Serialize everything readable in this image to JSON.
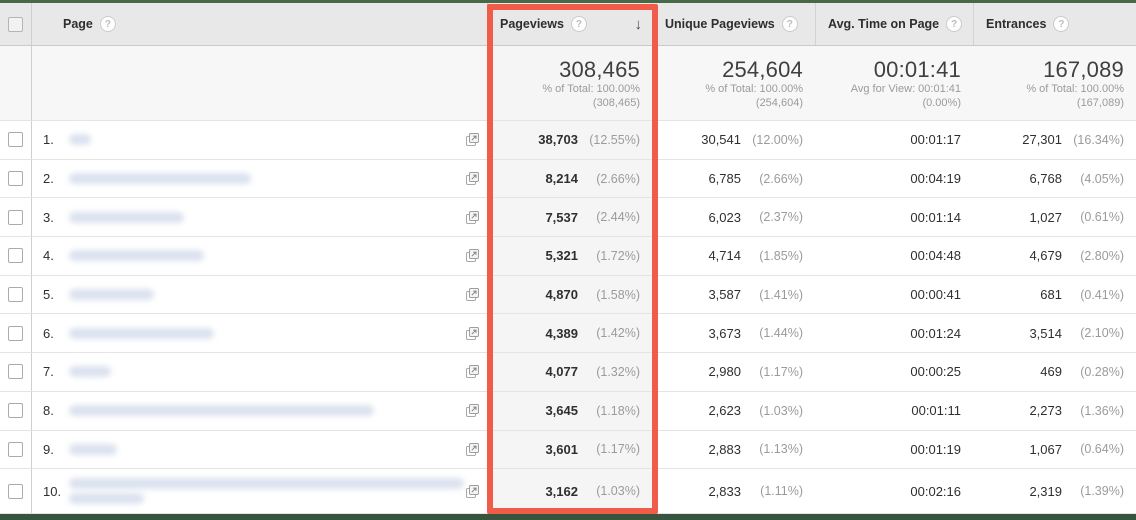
{
  "colors": {
    "highlight_red": "#f05b4a",
    "frame_green_top": "#476948",
    "frame_green_bottom": "#37553c",
    "blur_link": "#dbe2ee"
  },
  "icons": {
    "help": "?",
    "sort_desc": "↓"
  },
  "header": {
    "columns": [
      {
        "label": "Page"
      },
      {
        "label": "Pageviews",
        "sorted": "descending"
      },
      {
        "label": "Unique Pageviews"
      },
      {
        "label": "Avg. Time on Page"
      },
      {
        "label": "Entrances"
      }
    ]
  },
  "summary": {
    "pageviews": {
      "value": "308,465",
      "line2": "% of Total: 100.00%",
      "line3": "(308,465)"
    },
    "unique_pageviews": {
      "value": "254,604",
      "line2": "% of Total: 100.00%",
      "line3": "(254,604)"
    },
    "avg_time_on_page": {
      "value": "00:01:41",
      "line2": "Avg for View: 00:01:41",
      "line3": "(0.00%)"
    },
    "entrances": {
      "value": "167,089",
      "line2": "% of Total: 100.00%",
      "line3": "(167,089)"
    }
  },
  "rows": [
    {
      "index": "1.",
      "blur_bar_widths": [
        22
      ],
      "pageviews": "38,703",
      "pageviews_pct": "(12.55%)",
      "unique_pageviews": "30,541",
      "unique_pageviews_pct": "(12.00%)",
      "avg_time": "00:01:17",
      "entrances": "27,301",
      "entrances_pct": "(16.34%)"
    },
    {
      "index": "2.",
      "blur_bar_widths": [
        182
      ],
      "pageviews": "8,214",
      "pageviews_pct": "(2.66%)",
      "unique_pageviews": "6,785",
      "unique_pageviews_pct": "(2.66%)",
      "avg_time": "00:04:19",
      "entrances": "6,768",
      "entrances_pct": "(4.05%)"
    },
    {
      "index": "3.",
      "blur_bar_widths": [
        115
      ],
      "pageviews": "7,537",
      "pageviews_pct": "(2.44%)",
      "unique_pageviews": "6,023",
      "unique_pageviews_pct": "(2.37%)",
      "avg_time": "00:01:14",
      "entrances": "1,027",
      "entrances_pct": "(0.61%)"
    },
    {
      "index": "4.",
      "blur_bar_widths": [
        135
      ],
      "pageviews": "5,321",
      "pageviews_pct": "(1.72%)",
      "unique_pageviews": "4,714",
      "unique_pageviews_pct": "(1.85%)",
      "avg_time": "00:04:48",
      "entrances": "4,679",
      "entrances_pct": "(2.80%)"
    },
    {
      "index": "5.",
      "blur_bar_widths": [
        85
      ],
      "pageviews": "4,870",
      "pageviews_pct": "(1.58%)",
      "unique_pageviews": "3,587",
      "unique_pageviews_pct": "(1.41%)",
      "avg_time": "00:00:41",
      "entrances": "681",
      "entrances_pct": "(0.41%)"
    },
    {
      "index": "6.",
      "blur_bar_widths": [
        145
      ],
      "pageviews": "4,389",
      "pageviews_pct": "(1.42%)",
      "unique_pageviews": "3,673",
      "unique_pageviews_pct": "(1.44%)",
      "avg_time": "00:01:24",
      "entrances": "3,514",
      "entrances_pct": "(2.10%)"
    },
    {
      "index": "7.",
      "blur_bar_widths": [
        42
      ],
      "pageviews": "4,077",
      "pageviews_pct": "(1.32%)",
      "unique_pageviews": "2,980",
      "unique_pageviews_pct": "(1.17%)",
      "avg_time": "00:00:25",
      "entrances": "469",
      "entrances_pct": "(0.28%)"
    },
    {
      "index": "8.",
      "blur_bar_widths": [
        305
      ],
      "pageviews": "3,645",
      "pageviews_pct": "(1.18%)",
      "unique_pageviews": "2,623",
      "unique_pageviews_pct": "(1.03%)",
      "avg_time": "00:01:11",
      "entrances": "2,273",
      "entrances_pct": "(1.36%)"
    },
    {
      "index": "9.",
      "blur_bar_widths": [
        48
      ],
      "pageviews": "3,601",
      "pageviews_pct": "(1.17%)",
      "unique_pageviews": "2,883",
      "unique_pageviews_pct": "(1.13%)",
      "avg_time": "00:01:19",
      "entrances": "1,067",
      "entrances_pct": "(0.64%)"
    },
    {
      "index": "10.",
      "blur_bar_widths": [
        395,
        75
      ],
      "pageviews": "3,162",
      "pageviews_pct": "(1.03%)",
      "unique_pageviews": "2,833",
      "unique_pageviews_pct": "(1.11%)",
      "avg_time": "00:02:16",
      "entrances": "2,319",
      "entrances_pct": "(1.39%)"
    }
  ]
}
